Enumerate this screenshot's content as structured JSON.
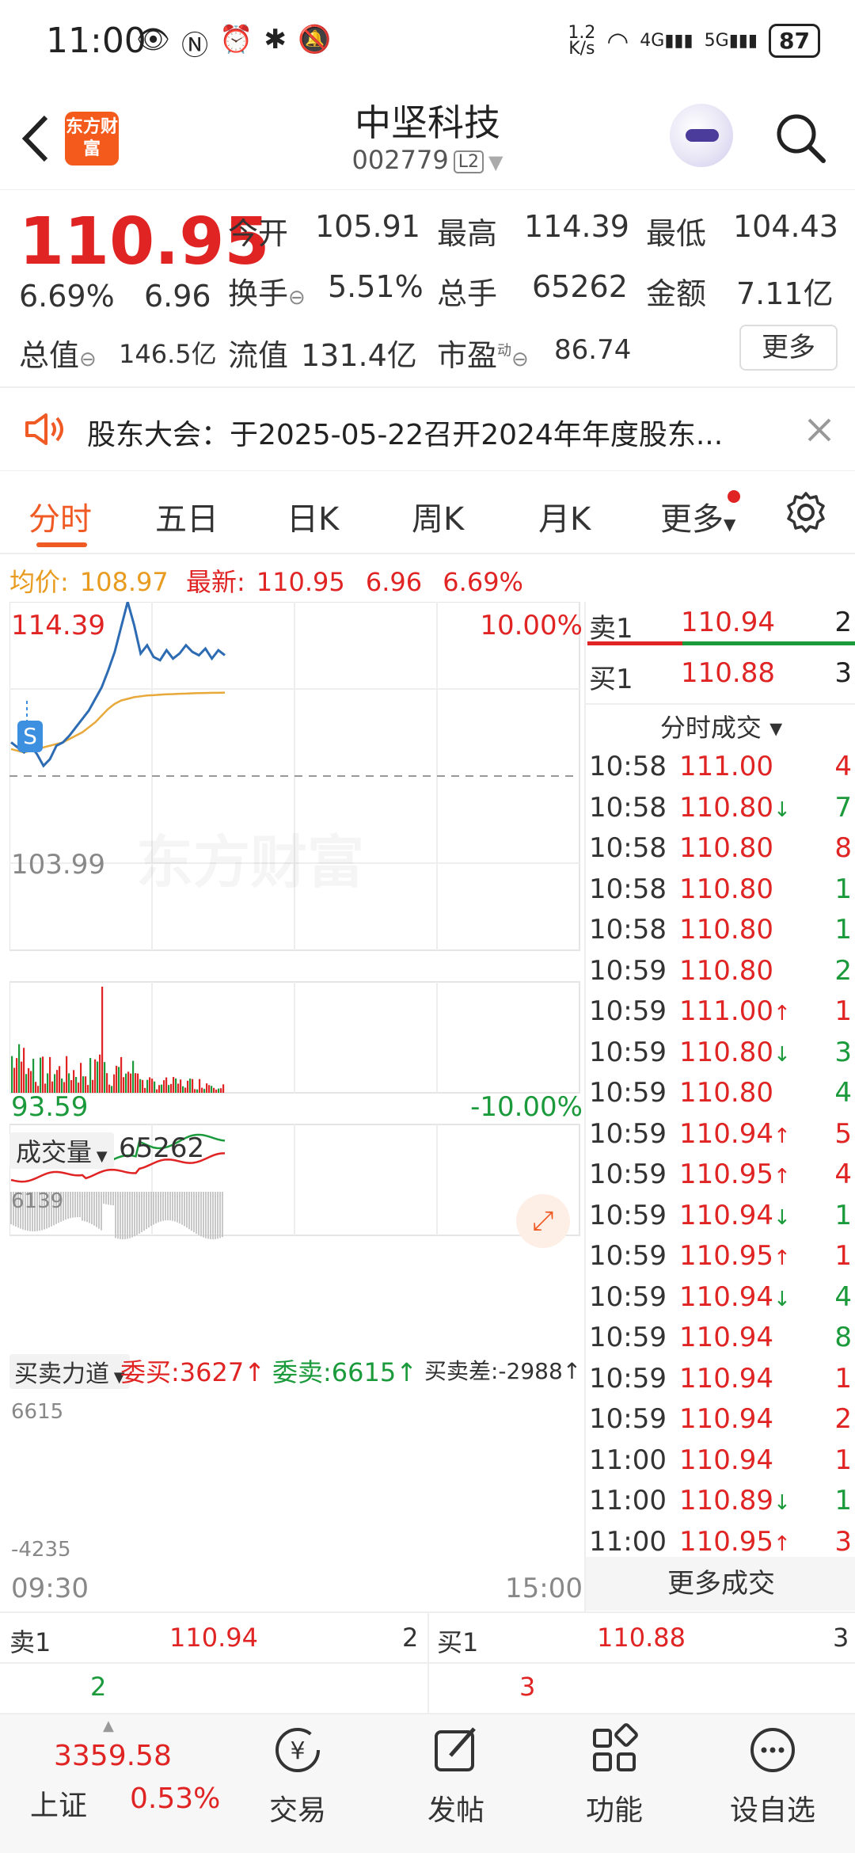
{
  "status": {
    "time": "11:00",
    "net_speed": "1.2\nK/s",
    "net_speed_top": "1.2",
    "net_speed_bottom": "K/s",
    "sig1": "4G",
    "sig2": "5G",
    "battery": "87"
  },
  "header": {
    "logo_text": "东方财富",
    "stock_name": "中坚科技",
    "stock_code": "002779",
    "level": "L2"
  },
  "quote": {
    "price": "110.95",
    "change_pct": "6.69%",
    "change": "6.96",
    "open_label": "今开",
    "open": "105.91",
    "high_label": "最高",
    "high": "114.39",
    "low_label": "最低",
    "low": "104.43",
    "turnover_label": "换手",
    "turnover": "5.51%",
    "volume_label": "总手",
    "volume": "65262",
    "amount_label": "金额",
    "amount": "7.11亿",
    "mktcap_label": "总值",
    "mktcap": "146.5亿",
    "float_label": "流值",
    "float": "131.4亿",
    "pe_label": "市盈",
    "pe_sup": "动",
    "pe": "86.74",
    "more": "更多"
  },
  "notice": {
    "text": "股东大会：于2025-05-22召开2024年年度股东..."
  },
  "tabs": [
    "分时",
    "五日",
    "日K",
    "周K",
    "月K",
    "更多"
  ],
  "avg": {
    "avg_label": "均价:",
    "avg": "108.97",
    "latest_label": "最新:",
    "latest": "110.95",
    "chg": "6.96",
    "pct": "6.69%"
  },
  "chart": {
    "y_high": "114.39",
    "y_low": "93.59",
    "pct_high": "10.00%",
    "pct_low": "-10.00%",
    "prev_close": "103.99",
    "watermark": "东方财富",
    "marker": "S",
    "vol_label": "成交量",
    "vol_value": "65262",
    "vol_max": "6139",
    "force_label": "买卖力道",
    "bid_label": "委买:3627",
    "ask_label": "委卖:6615",
    "diff_label": "买卖差:-2988",
    "force_top": "6615",
    "force_bottom": "-4235",
    "t_start": "09:30",
    "t_end": "15:00",
    "colors": {
      "price_line": "#2d6bb3",
      "avg_line": "#e8a93a",
      "up": "#e02424",
      "down": "#1b9a3b"
    },
    "price_series": [
      106.0,
      105.7,
      105.4,
      105.8,
      105.3,
      104.6,
      105.0,
      105.8,
      106.0,
      106.4,
      106.9,
      107.4,
      107.9,
      108.6,
      109.3,
      110.3,
      111.4,
      112.9,
      114.39,
      113.0,
      111.3,
      111.8,
      111.1,
      110.9,
      111.5,
      111.0,
      111.3,
      111.8,
      111.4,
      111.2,
      111.6,
      111.0,
      111.5,
      111.2
    ],
    "avg_series": [
      105.6,
      105.5,
      105.4,
      105.5,
      105.6,
      105.7,
      105.8,
      105.9,
      106.0,
      106.2,
      106.4,
      106.6,
      106.9,
      107.2,
      107.6,
      108.0,
      108.3,
      108.5,
      108.6,
      108.7,
      108.75,
      108.8,
      108.82,
      108.85,
      108.87,
      108.88,
      108.9,
      108.91,
      108.93,
      108.94,
      108.95,
      108.96,
      108.96,
      108.97
    ]
  },
  "book": {
    "ask1_label": "卖1",
    "ask1_price": "110.94",
    "ask1_vol": "2",
    "bid1_label": "买1",
    "bid1_price": "110.88",
    "bid1_vol": "3",
    "ticks_title": "分时成交",
    "ticks": [
      {
        "t": "10:58",
        "p": "111.00",
        "v": "4",
        "dir": "",
        "c": "red"
      },
      {
        "t": "10:58",
        "p": "110.80",
        "v": "7",
        "dir": "↓",
        "c": "green"
      },
      {
        "t": "10:58",
        "p": "110.80",
        "v": "8",
        "dir": "",
        "c": "red"
      },
      {
        "t": "10:58",
        "p": "110.80",
        "v": "1",
        "dir": "",
        "c": "green"
      },
      {
        "t": "10:58",
        "p": "110.80",
        "v": "1",
        "dir": "",
        "c": "green"
      },
      {
        "t": "10:59",
        "p": "110.80",
        "v": "2",
        "dir": "",
        "c": "green"
      },
      {
        "t": "10:59",
        "p": "111.00",
        "v": "1",
        "dir": "↑",
        "c": "red"
      },
      {
        "t": "10:59",
        "p": "110.80",
        "v": "3",
        "dir": "↓",
        "c": "green"
      },
      {
        "t": "10:59",
        "p": "110.80",
        "v": "4",
        "dir": "",
        "c": "green"
      },
      {
        "t": "10:59",
        "p": "110.94",
        "v": "5",
        "dir": "↑",
        "c": "red"
      },
      {
        "t": "10:59",
        "p": "110.95",
        "v": "4",
        "dir": "↑",
        "c": "red"
      },
      {
        "t": "10:59",
        "p": "110.94",
        "v": "1",
        "dir": "↓",
        "c": "green"
      },
      {
        "t": "10:59",
        "p": "110.95",
        "v": "1",
        "dir": "↑",
        "c": "red"
      },
      {
        "t": "10:59",
        "p": "110.94",
        "v": "4",
        "dir": "↓",
        "c": "green"
      },
      {
        "t": "10:59",
        "p": "110.94",
        "v": "8",
        "dir": "",
        "c": "green"
      },
      {
        "t": "10:59",
        "p": "110.94",
        "v": "1",
        "dir": "",
        "c": "red"
      },
      {
        "t": "10:59",
        "p": "110.94",
        "v": "2",
        "dir": "",
        "c": "red"
      },
      {
        "t": "11:00",
        "p": "110.94",
        "v": "1",
        "dir": "",
        "c": "red"
      },
      {
        "t": "11:00",
        "p": "110.89",
        "v": "1",
        "dir": "↓",
        "c": "green"
      },
      {
        "t": "11:00",
        "p": "110.95",
        "v": "3",
        "dir": "↑",
        "c": "red"
      }
    ],
    "more_ticks": "更多成交"
  },
  "bottom_book": {
    "ask_label": "卖1",
    "ask_price": "110.94",
    "ask_vol": "2",
    "bid_label": "买1",
    "bid_price": "110.88",
    "bid_vol": "3",
    "ask_count": "2",
    "bid_count": "3"
  },
  "nav": {
    "index_value": "3359.58",
    "index_name": "上证",
    "index_pct": "0.53%",
    "items": [
      "交易",
      "发帖",
      "功能",
      "设自选"
    ]
  }
}
